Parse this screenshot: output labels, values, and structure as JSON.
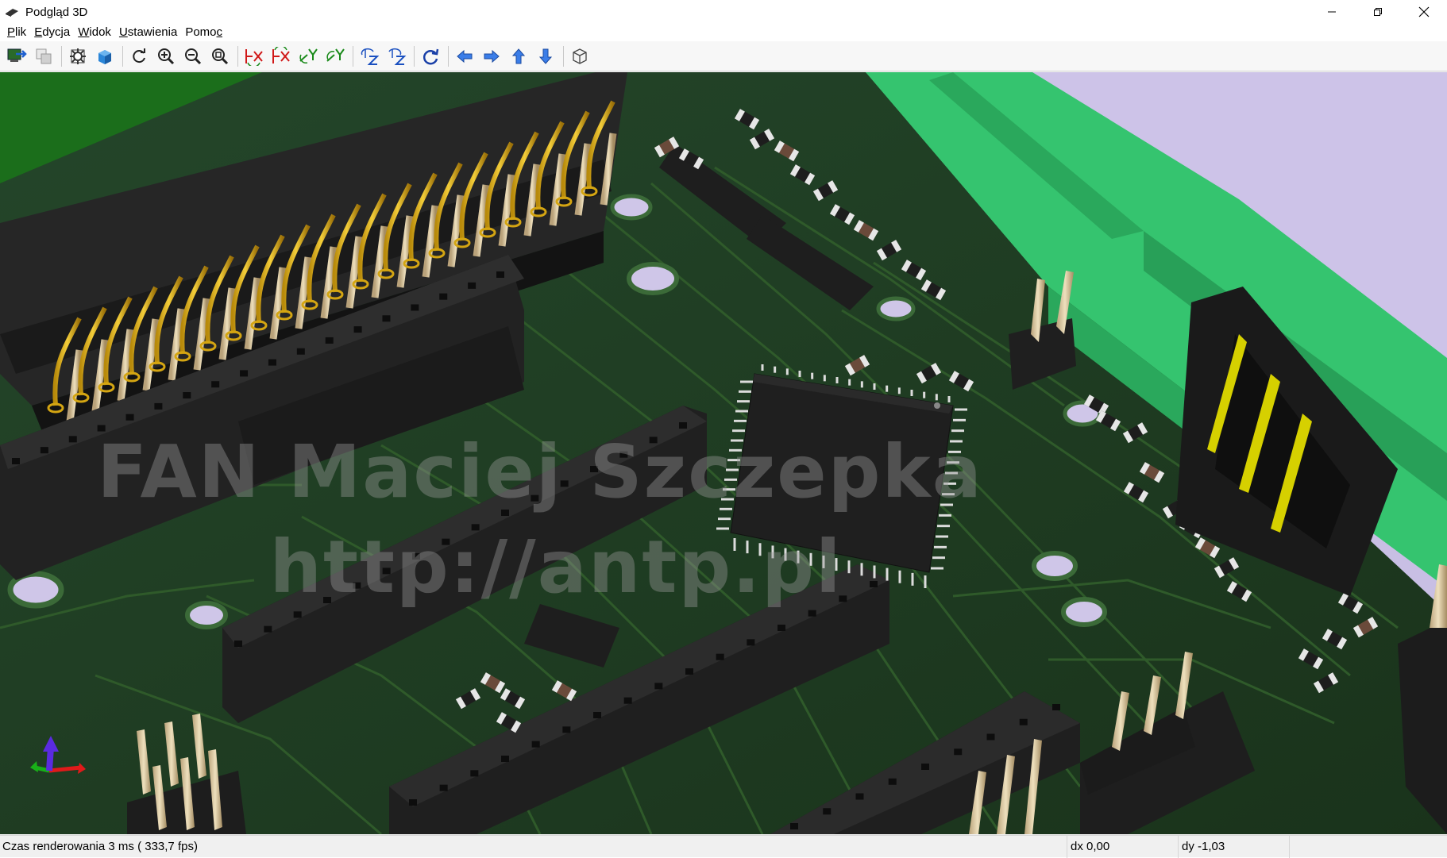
{
  "window": {
    "title": "Podgląd 3D",
    "controls": {
      "minimize": "minimize",
      "restore": "restore",
      "close": "close"
    }
  },
  "menu": {
    "items": [
      {
        "accel": "P",
        "rest": "lik"
      },
      {
        "accel": "E",
        "rest": "dycja"
      },
      {
        "accel": "W",
        "rest": "idok"
      },
      {
        "accel": "U",
        "rest": "stawienia"
      },
      {
        "prefix": "Pomo",
        "accel": "c"
      }
    ]
  },
  "toolbar": {
    "buttons": [
      "export-icon",
      "copy-image-icon",
      "settings-icon",
      "render-mode-icon",
      "reload-icon",
      "zoom-in-icon",
      "zoom-out-icon",
      "zoom-fit-icon",
      "rotate-x-cw-icon",
      "rotate-x-ccw-icon",
      "rotate-y-cw-icon",
      "rotate-y-ccw-icon",
      "rotate-z-cw-icon",
      "rotate-z-ccw-icon",
      "flip-board-icon",
      "move-left-icon",
      "move-right-icon",
      "move-up-icon",
      "move-down-icon",
      "ortho-view-icon"
    ]
  },
  "viewport": {
    "watermark_line1": "FAN Maciej Szczepka",
    "watermark_line2": "http://antp.pl",
    "colors": {
      "pcb": "#1e3a1c",
      "trace": "#2f5a2a",
      "component_body": "#242424",
      "pin_gold": "#d4a512",
      "terminal_block": "#35c46f",
      "background": "#c8bfe4"
    }
  },
  "status": {
    "render_time": "Czas renderowania 3 ms ( 333,7 fps)",
    "dx": "dx 0,00",
    "dy": "dy -1,03"
  }
}
